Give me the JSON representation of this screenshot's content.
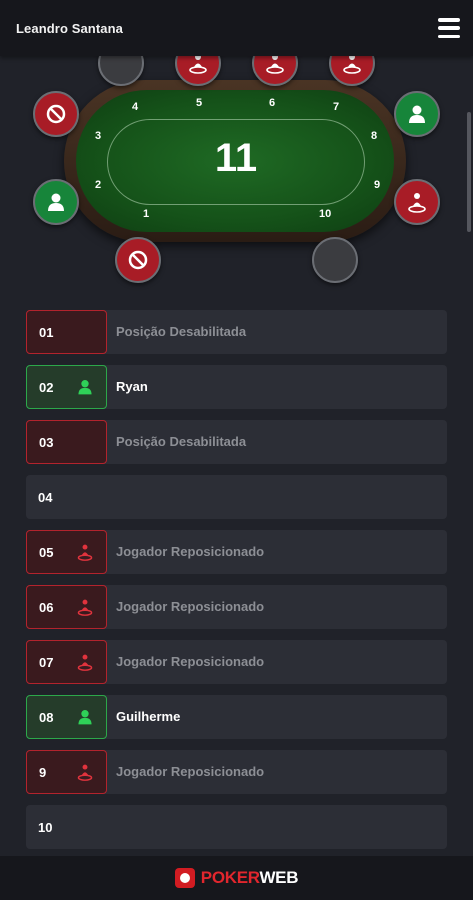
{
  "header": {
    "user_name": "Leandro Santana",
    "menu_icon": "hamburger-menu-icon"
  },
  "table": {
    "number": "11",
    "seat_numbers": [
      "1",
      "2",
      "3",
      "4",
      "5",
      "6",
      "7",
      "8",
      "9",
      "10"
    ]
  },
  "seats_state": [
    {
      "seat": "top-left",
      "state": "empty"
    },
    {
      "seat": "top-2",
      "state": "moved"
    },
    {
      "seat": "top-3",
      "state": "moved"
    },
    {
      "seat": "top-4",
      "state": "moved"
    },
    {
      "seat": "left-upper",
      "state": "disabled"
    },
    {
      "seat": "left-lower",
      "state": "occupied"
    },
    {
      "seat": "bottom-left",
      "state": "disabled"
    },
    {
      "seat": "right-upper",
      "state": "occupied"
    },
    {
      "seat": "right-lower",
      "state": "moved"
    },
    {
      "seat": "bottom-right",
      "state": "empty"
    }
  ],
  "positions": [
    {
      "num": "01",
      "state": "disabled",
      "label": "Posição Desabilitada",
      "icon": ""
    },
    {
      "num": "02",
      "state": "occupied",
      "label": "Ryan",
      "icon": "player-icon"
    },
    {
      "num": "03",
      "state": "disabled",
      "label": "Posição Desabilitada",
      "icon": ""
    },
    {
      "num": "04",
      "state": "empty",
      "label": "",
      "icon": ""
    },
    {
      "num": "05",
      "state": "moved",
      "label": "Jogador Reposicionado",
      "icon": "repositioned-player-icon"
    },
    {
      "num": "06",
      "state": "moved",
      "label": "Jogador Reposicionado",
      "icon": "repositioned-player-icon"
    },
    {
      "num": "07",
      "state": "moved",
      "label": "Jogador Reposicionado",
      "icon": "repositioned-player-icon"
    },
    {
      "num": "08",
      "state": "occupied",
      "label": "Guilherme",
      "icon": "player-icon"
    },
    {
      "num": "9",
      "state": "moved",
      "label": "Jogador Reposicionado",
      "icon": "repositioned-player-icon"
    },
    {
      "num": "10",
      "state": "empty",
      "label": "",
      "icon": ""
    }
  ],
  "footer": {
    "brand_part1": "POKER",
    "brand_part2": "WEB"
  },
  "colors": {
    "background": "#202229",
    "header": "#16171c",
    "disabled_red": "#b3232d",
    "occupied_green": "#2ca84a",
    "felt_green": "#155219",
    "brand_red": "#e1262d"
  }
}
